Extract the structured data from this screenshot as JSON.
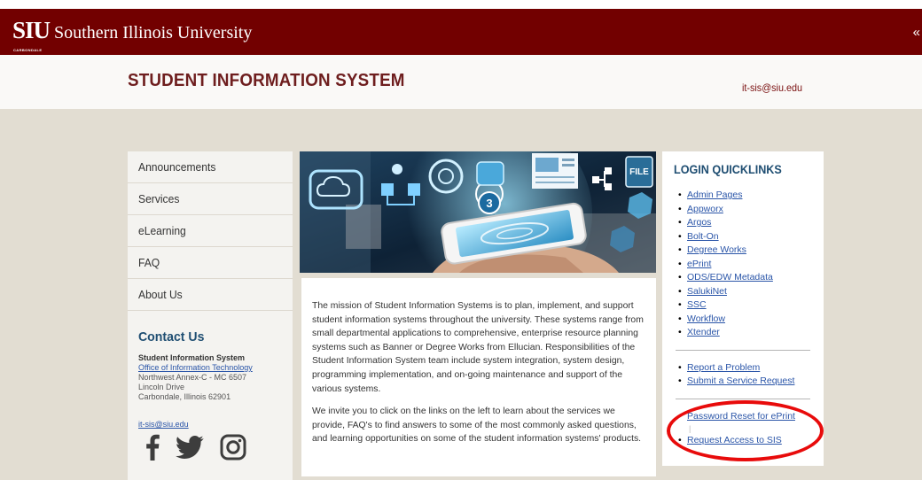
{
  "brand": {
    "mark": "SIU",
    "name": "Southern Illinois University",
    "campus": "CARBONDALE",
    "collapse_glyph": "«"
  },
  "header": {
    "title": "STUDENT INFORMATION SYSTEM",
    "email": "it-sis@siu.edu"
  },
  "nav": {
    "items": [
      {
        "label": "Announcements"
      },
      {
        "label": "Services"
      },
      {
        "label": "eLearning"
      },
      {
        "label": "FAQ"
      },
      {
        "label": "About Us"
      }
    ]
  },
  "contact": {
    "title": "Contact Us",
    "org": "Student Information System",
    "office": "Office of Information Technology",
    "address1": "Northwest Annex-C - MC 6507",
    "address2": "Lincoln Drive",
    "address3": "Carbondale, Illinois 62901",
    "email": "it-sis@siu.edu",
    "socials": [
      {
        "icon": "facebook-icon"
      },
      {
        "icon": "twitter-icon"
      },
      {
        "icon": "instagram-icon"
      }
    ]
  },
  "mission": {
    "para1": "The mission of Student Information Systems is to plan, implement, and support student information systems throughout the university. These systems range from small departmental applications to comprehensive, enterprise resource planning systems such as Banner or Degree Works from Ellucian. Responsibilities of the Student Information System team include system integration, system design, programming implementation, and on-going maintenance and support of the various systems.",
    "para2": "We invite you to click on the links on the left to learn about the services we provide, FAQ's to find answers to some of the most commonly asked questions, and learning opportunities on some of the student information systems' products."
  },
  "quicklinks": {
    "title": "LOGIN QUICKLINKS",
    "login_links": [
      {
        "label": "Admin Pages"
      },
      {
        "label": "Appworx"
      },
      {
        "label": "Argos"
      },
      {
        "label": "Bolt-On"
      },
      {
        "label": "Degree Works"
      },
      {
        "label": "ePrint"
      },
      {
        "label": "ODS/EDW Metadata"
      },
      {
        "label": "SalukiNet"
      },
      {
        "label": "SSC"
      },
      {
        "label": "Workflow"
      },
      {
        "label": "Xtender"
      }
    ],
    "support_links": [
      {
        "label": "Report a Problem"
      },
      {
        "label": "Submit a Service Request"
      }
    ],
    "account_links": [
      {
        "label": "Password Reset for ePrint"
      },
      {
        "label": "Request Access to SIS"
      }
    ],
    "pipe": "|"
  },
  "colors": {
    "brand_maroon": "#720000",
    "title_maroon": "#6e1e1e",
    "heading_blue": "#1f4e72",
    "link_blue": "#2a55a8",
    "page_beige": "#e2ddd2",
    "highlight_red": "#e80b0b"
  },
  "hero_image": {
    "file_badge": "FILE",
    "number_badge": "3"
  }
}
